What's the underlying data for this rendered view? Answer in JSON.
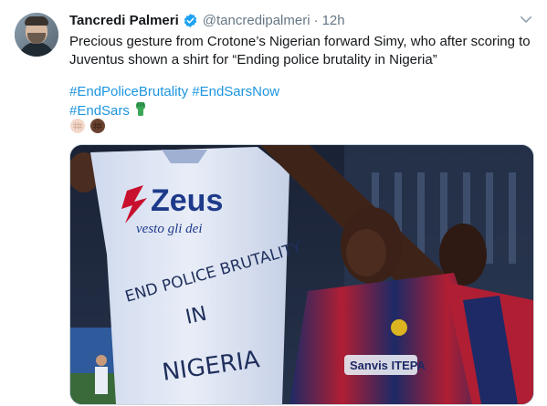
{
  "tweet": {
    "author_name": "Tancredi Palmeri",
    "author_handle": "@tancredipalmeri",
    "separator": "·",
    "timestamp": "12h",
    "text_line1": "Precious gesture from Crotone’s Nigerian forward Simy, who after scoring to",
    "text_line2": "Juventus shown a shirt for “Ending police brutality in Nigeria”",
    "hashtags": [
      "#EndPoliceBrutality",
      "#EndSarsNow",
      "#EndSars"
    ],
    "emoji_after_hashtags": "green-raised-fist",
    "emoji_row": [
      "light-raised-fist",
      "dark-raised-fist"
    ]
  },
  "media": {
    "shirt_brand": "Zeus",
    "shirt_slogan": "vesto gli dei",
    "shirt_handwriting_line1": "END POLICE BRUTALITY",
    "shirt_handwriting_line2": "IN",
    "shirt_handwriting_line3": "NIGERIA",
    "jersey_text": "Sanvis ITEPA"
  },
  "colors": {
    "link": "#1b95e0",
    "verified": "#1da1f2",
    "secondary_text": "#657786"
  },
  "icons": [
    "verified-badge-icon",
    "chevron-down-icon"
  ]
}
